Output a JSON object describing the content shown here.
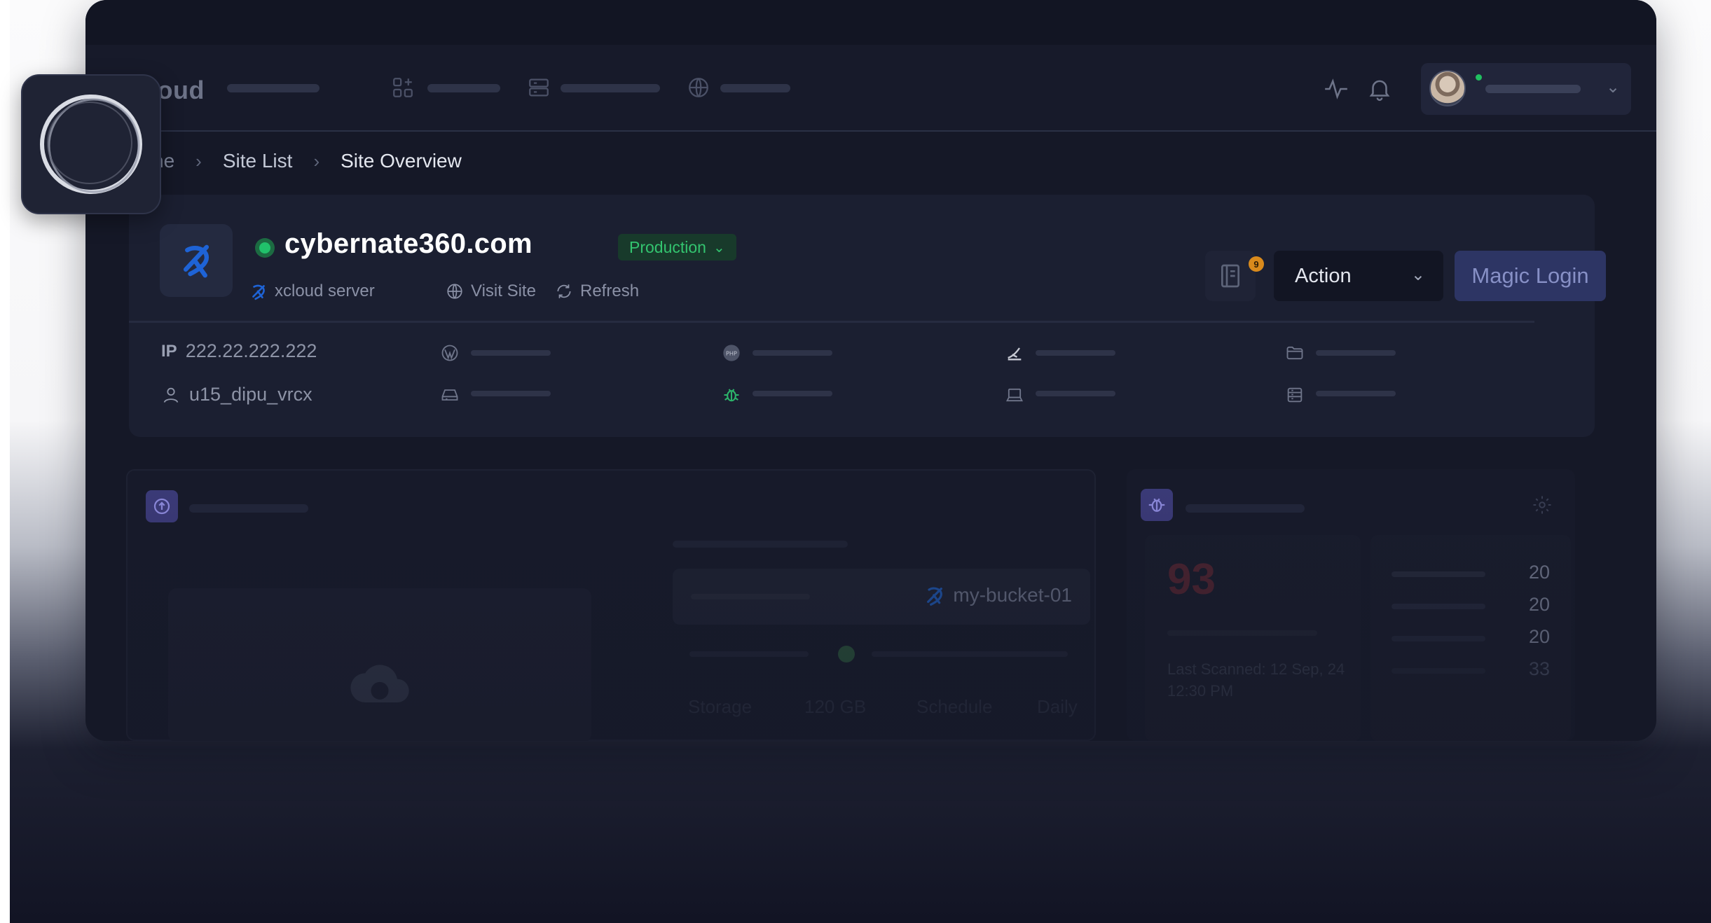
{
  "app": {
    "brand_partial": "loud",
    "breadcrumb": {
      "home_partial": "ne",
      "site_list": "Site List",
      "current": "Site Overview"
    }
  },
  "site": {
    "name": "cybernate360.com",
    "environment": "Production",
    "server_name": "xcloud server",
    "visit_label": "Visit Site",
    "refresh_label": "Refresh",
    "notes_count": "9",
    "action_label": "Action",
    "magic_login_label": "Magic Login",
    "ip_label": "IP",
    "ip_value": "222.22.222.222",
    "user_value": "u15_dipu_vrcx"
  },
  "backup_panel": {
    "bucket_name": "my-bucket-01",
    "storage_label": "Storage",
    "storage_value": "120 GB",
    "schedule_label": "Schedule",
    "schedule_value": "Daily"
  },
  "security_panel": {
    "score": "93",
    "last_scanned": "Last Scanned: 12 Sep, 24 12:30 PM",
    "counts": [
      "20",
      "20",
      "20",
      "33"
    ]
  },
  "colors": {
    "accent": "#2d3564",
    "success": "#21c16b",
    "warning": "#d98a1c",
    "brand_blue": "#1e63d6"
  },
  "icons": {
    "floating_logo": "ring-logo-icon",
    "site_logo": "xcloud-logo-icon"
  }
}
